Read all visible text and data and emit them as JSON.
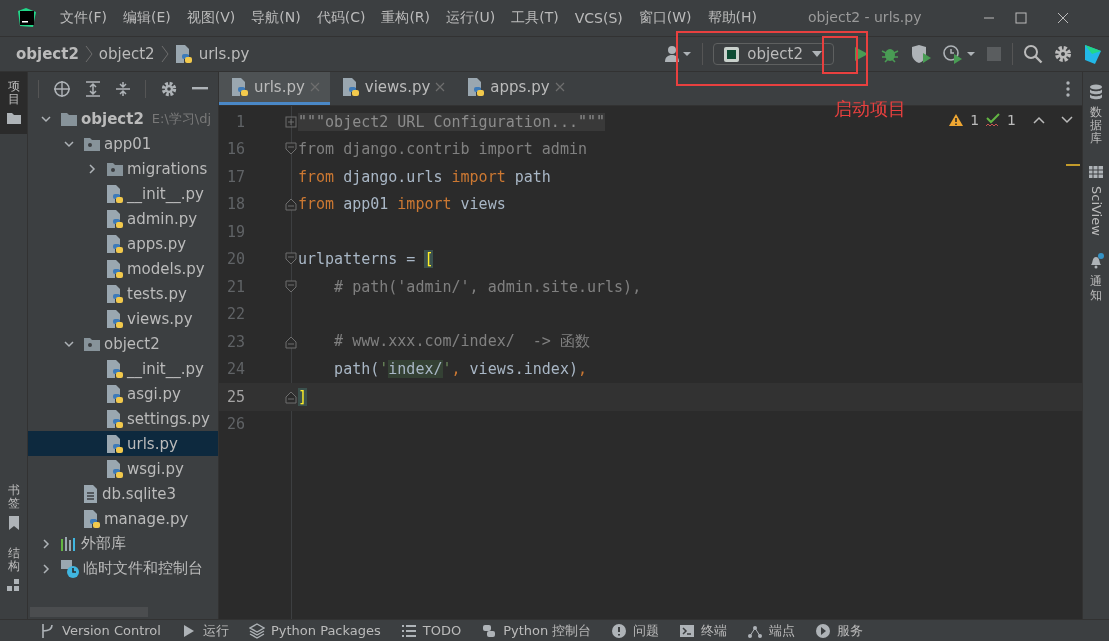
{
  "window": {
    "title": "object2 - urls.py"
  },
  "menu": [
    "文件(F)",
    "编辑(E)",
    "视图(V)",
    "导航(N)",
    "代码(C)",
    "重构(R)",
    "运行(U)",
    "工具(T)",
    "VCS(S)",
    "窗口(W)",
    "帮助(H)"
  ],
  "breadcrumbs": [
    {
      "label": "object2",
      "bold": true,
      "kind": "folder"
    },
    {
      "label": "object2",
      "bold": false,
      "kind": "folder"
    },
    {
      "label": "urls.py",
      "bold": false,
      "kind": "python"
    }
  ],
  "run_config": {
    "label": "object2"
  },
  "left_stripe": [
    {
      "label": "项目",
      "selected": true,
      "kind": "project"
    },
    {
      "label": "书签",
      "selected": false,
      "kind": "bookmarks"
    },
    {
      "label": "结构",
      "selected": false,
      "kind": "structure"
    }
  ],
  "project_tree": [
    {
      "label": "object2",
      "hint": "E:\\学习\\dj",
      "kind": "folder",
      "expanded": true,
      "selected": false,
      "children": [
        {
          "label": "app01",
          "kind": "package",
          "expanded": true,
          "selected": false,
          "children": [
            {
              "label": "migrations",
              "kind": "package",
              "expanded": false,
              "selected": false
            },
            {
              "label": "__init__.py",
              "kind": "python",
              "selected": false
            },
            {
              "label": "admin.py",
              "kind": "python",
              "selected": false
            },
            {
              "label": "apps.py",
              "kind": "python",
              "selected": false
            },
            {
              "label": "models.py",
              "kind": "python",
              "selected": false
            },
            {
              "label": "tests.py",
              "kind": "python",
              "selected": false
            },
            {
              "label": "views.py",
              "kind": "python",
              "selected": false
            }
          ]
        },
        {
          "label": "object2",
          "kind": "package",
          "expanded": true,
          "selected": false,
          "children": [
            {
              "label": "__init__.py",
              "kind": "python",
              "selected": false
            },
            {
              "label": "asgi.py",
              "kind": "python",
              "selected": false
            },
            {
              "label": "settings.py",
              "kind": "python",
              "selected": false
            },
            {
              "label": "urls.py",
              "kind": "python",
              "selected": true
            },
            {
              "label": "wsgi.py",
              "kind": "python",
              "selected": false
            }
          ]
        },
        {
          "label": "db.sqlite3",
          "kind": "text",
          "selected": false
        },
        {
          "label": "manage.py",
          "kind": "python",
          "selected": false
        }
      ]
    },
    {
      "label": "外部库",
      "kind": "library",
      "expanded": false,
      "selected": false
    },
    {
      "label": "临时文件和控制台",
      "kind": "scratch",
      "expanded": false,
      "selected": false
    }
  ],
  "tabs": [
    {
      "label": "urls.py",
      "selected": true
    },
    {
      "label": "views.py",
      "selected": false
    },
    {
      "label": "apps.py",
      "selected": false
    }
  ],
  "inspections": {
    "warnings": "1",
    "typos": "1"
  },
  "code_lines": [
    {
      "number": "1",
      "current": false,
      "folded": true,
      "tokens": [
        {
          "kind": "docstring",
          "text": "\"\"\"object2 URL Configuration...\"\"\""
        }
      ]
    },
    {
      "number": "16",
      "current": false,
      "fold_start": true,
      "tokens": [
        {
          "kind": "unused",
          "text": "from django.contrib import admin"
        }
      ]
    },
    {
      "number": "17",
      "current": false,
      "tokens": [
        {
          "kind": "keyword",
          "text": "from"
        },
        {
          "kind": "plain",
          "text": " django.urls "
        },
        {
          "kind": "keyword",
          "text": "import"
        },
        {
          "kind": "plain",
          "text": " path"
        }
      ]
    },
    {
      "number": "18",
      "current": false,
      "fold_end": true,
      "tokens": [
        {
          "kind": "keyword",
          "text": "from"
        },
        {
          "kind": "plain",
          "text": " app01 "
        },
        {
          "kind": "keyword",
          "text": "import"
        },
        {
          "kind": "plain",
          "text": " views"
        }
      ]
    },
    {
      "number": "19",
      "current": false
    },
    {
      "number": "20",
      "current": false,
      "fold_start": true,
      "tokens": [
        {
          "kind": "plain",
          "text": "urlpatterns = "
        },
        {
          "kind": "bracket",
          "text": "["
        }
      ]
    },
    {
      "number": "21",
      "current": false,
      "fold_start": true,
      "tokens": [
        {
          "kind": "comment",
          "text": "    # path('admin/', admin.site.urls),"
        }
      ]
    },
    {
      "number": "22",
      "current": false
    },
    {
      "number": "23",
      "current": false,
      "fold_end": true,
      "tokens": [
        {
          "kind": "comment",
          "text": "    # www.xxx.com/index/  -> 函数"
        }
      ]
    },
    {
      "number": "24",
      "current": false,
      "tokens": [
        {
          "kind": "plain",
          "text": "    path("
        },
        {
          "kind": "string",
          "text": "'"
        },
        {
          "kind": "highlight",
          "text": "index/"
        },
        {
          "kind": "string",
          "text": "'"
        },
        {
          "kind": "keyword",
          "text": ", "
        },
        {
          "kind": "plain",
          "text": "views.index)"
        },
        {
          "kind": "keyword",
          "text": ","
        }
      ]
    },
    {
      "number": "25",
      "current": true,
      "fold_end": true,
      "tokens": [
        {
          "kind": "bracket",
          "text": "]"
        }
      ]
    },
    {
      "number": "26",
      "current": false
    }
  ],
  "right_stripe": [
    {
      "label": "数据库",
      "kind": "database"
    },
    {
      "label": "SciView",
      "kind": "sciview"
    },
    {
      "label": "通知",
      "kind": "notifications"
    }
  ],
  "status_bar": [
    "Version Control",
    "运行",
    "Python Packages",
    "TODO",
    "Python 控制台",
    "问题",
    "终端",
    "端点",
    "服务"
  ],
  "annotations": [
    {
      "kind": "frame"
    },
    {
      "kind": "frame"
    },
    {
      "kind": "label",
      "text": "启动项目"
    }
  ]
}
